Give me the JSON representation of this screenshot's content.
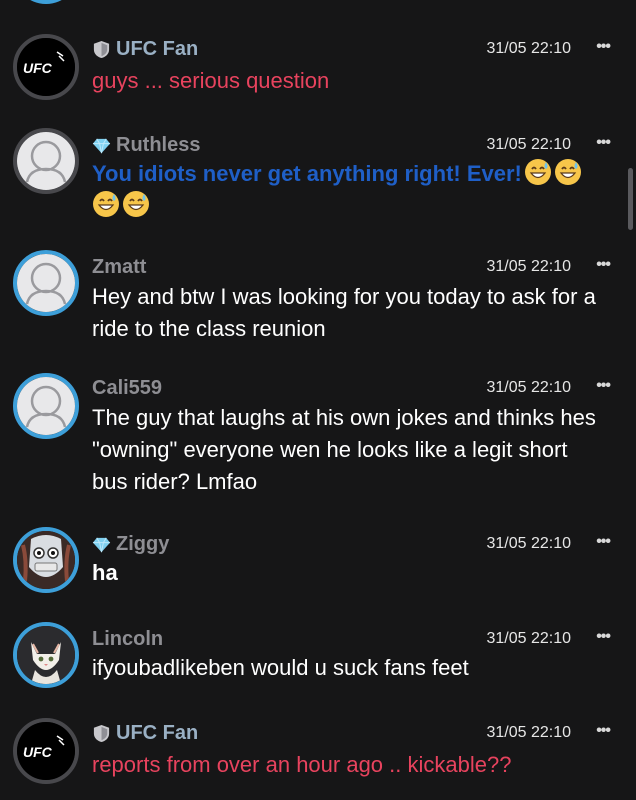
{
  "colors": {
    "background": "#161617",
    "accent_ring": "#3d9fd9",
    "red_text": "#e8435e",
    "blue_text": "#1f5fc7",
    "username_grey": "#8e8e93",
    "username_steel": "#9ab0c4"
  },
  "messages": [
    {
      "username": "UFC Fan",
      "badge": "shield-icon",
      "avatar": "ufc-logo",
      "avatar_text": "UFC",
      "time": "31/05 22:10",
      "text": "guys ... serious question",
      "style": "red"
    },
    {
      "username": "Ruthless",
      "badge": "diamond-icon",
      "avatar": "default-avatar",
      "time": "31/05 22:10",
      "text": "You idiots never get anything right! Ever!",
      "emojis": [
        "grinning-sweat-emoji",
        "grinning-sweat-emoji",
        "grinning-sweat-emoji",
        "grinning-sweat-emoji"
      ],
      "style": "blue"
    },
    {
      "username": "Zmatt",
      "avatar": "default-avatar",
      "time": "31/05 22:10",
      "text": "Hey and btw I was looking for you today to ask for a ride to the class reunion",
      "style": "white"
    },
    {
      "username": "Cali559",
      "avatar": "default-avatar",
      "time": "31/05 22:10",
      "text": "The guy that laughs at his own jokes and thinks hes \"owning\" everyone wen he looks like a legit short bus rider? Lmfao",
      "style": "white"
    },
    {
      "username": "Ziggy",
      "badge": "diamond-icon",
      "avatar": "mask-avatar",
      "time": "31/05 22:10",
      "text": "ha",
      "style": "bold"
    },
    {
      "username": "Lincoln",
      "avatar": "cat-avatar",
      "time": "31/05 22:10",
      "text": "ifyoubadlikeben would u suck fans feet",
      "style": "white"
    },
    {
      "username": "UFC Fan",
      "badge": "shield-icon",
      "avatar": "ufc-logo",
      "avatar_text": "UFC",
      "time": "31/05 22:10",
      "text": "reports from over an hour ago .. kickable??",
      "style": "red"
    }
  ],
  "more_icon": "•••"
}
